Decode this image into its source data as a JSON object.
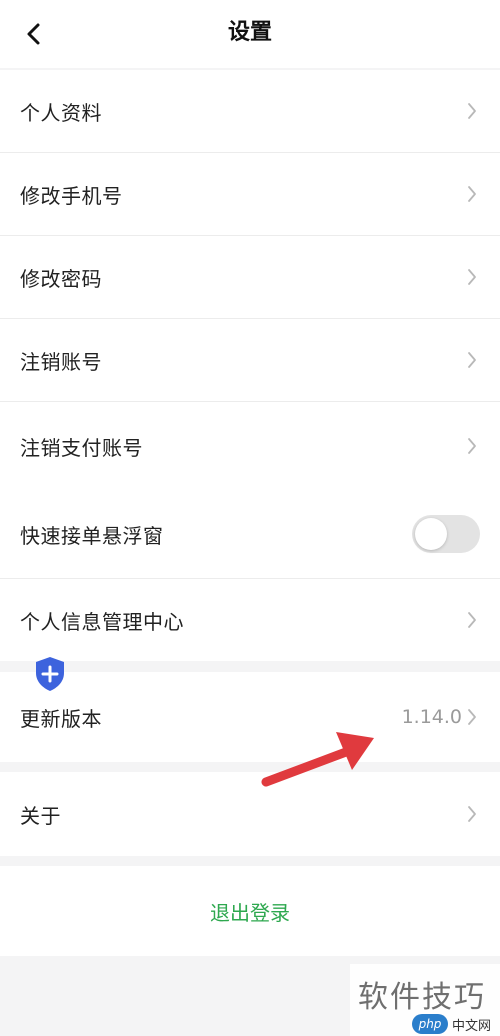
{
  "header": {
    "title": "设置",
    "back_icon": "chevron-left-icon"
  },
  "settings": {
    "profile_label": "个人资料",
    "change_phone_label": "修改手机号",
    "change_password_label": "修改密码",
    "cancel_account_label": "注销账号",
    "cancel_payment_account_label": "注销支付账号",
    "quick_order_float_label": "快速接单悬浮窗",
    "quick_order_float_enabled": false,
    "privacy_center_label": "个人信息管理中心",
    "update_version_label": "更新版本",
    "version_value": "1.14.0",
    "about_label": "关于"
  },
  "logout": {
    "label": "退出登录",
    "color": "#2ea84f"
  },
  "watermark": {
    "text": "软件技巧",
    "badge_php": "php",
    "badge_site": "中文网"
  },
  "colors": {
    "accent_green": "#2ea84f",
    "shield_blue": "#3d63dd",
    "annotation_arrow": "#e03a3e",
    "toggle_off": "#e3e3e3"
  }
}
